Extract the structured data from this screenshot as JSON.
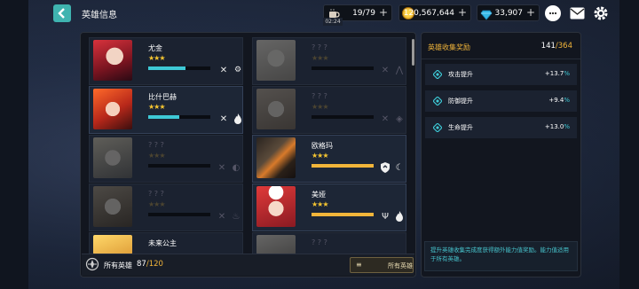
{
  "header": {
    "title": "英雄信息",
    "back_icon": "chevron-left-icon",
    "timer": "02:24"
  },
  "resources": [
    {
      "name": "stamina",
      "icon": "cup-icon",
      "value": "19/79",
      "plus": "+"
    },
    {
      "name": "gold",
      "icon": "coin-icon",
      "value": "120,567,644",
      "plus": "+"
    },
    {
      "name": "gems",
      "icon": "diamond-icon",
      "value": "33,907",
      "plus": "+"
    }
  ],
  "top_buttons": [
    "chat-icon",
    "mail-icon",
    "gear-icon"
  ],
  "heroes": [
    {
      "name": "尤金",
      "stars": "★★★",
      "locked": false,
      "progress": 0.6,
      "bar": "cyan",
      "icons": [
        "swords-icon",
        "settings-icon"
      ]
    },
    {
      "name": "? ? ?",
      "stars": "★★★",
      "locked": true,
      "progress": 0,
      "icons": [
        "swords-icon",
        "mountain-icon"
      ]
    },
    {
      "name": "比什巴赫",
      "stars": "★★★",
      "locked": false,
      "progress": 0.5,
      "bar": "cyan",
      "icons": [
        "swords-icon",
        "fire-icon"
      ]
    },
    {
      "name": "? ? ?",
      "stars": "★★★",
      "locked": true,
      "progress": 0,
      "icons": [
        "swords-icon",
        "diamond-element-icon"
      ]
    },
    {
      "name": "? ? ?",
      "stars": "★★★",
      "locked": true,
      "progress": 0,
      "icons": [
        "swords-icon",
        "water-drop-icon"
      ]
    },
    {
      "name": "欧格玛",
      "stars": "★★★",
      "locked": false,
      "progress": 1.0,
      "bar": "gold",
      "icons": [
        "shield-icon",
        "moon-icon"
      ]
    },
    {
      "name": "? ? ?",
      "stars": "★★★",
      "locked": true,
      "progress": 0,
      "icons": [
        "swords-icon",
        "fire-icon"
      ]
    },
    {
      "name": "美娅",
      "stars": "★★★",
      "locked": false,
      "progress": 1.0,
      "bar": "gold",
      "icons": [
        "staff-icon",
        "fire-icon"
      ]
    },
    {
      "name": "未来公主",
      "locked": false
    },
    {
      "name": "? ? ?",
      "locked": true
    }
  ],
  "footer": {
    "label": "所有英雄",
    "count": "87",
    "total": "/120",
    "filter_button": "所有英雄"
  },
  "reward_panel": {
    "title": "英雄收集奖励",
    "progress": "141",
    "progress_total": "/364",
    "stats": [
      {
        "label": "攻击提升",
        "value": "+13.7",
        "unit": "%"
      },
      {
        "label": "防御提升",
        "value": "+9.4",
        "unit": "%"
      },
      {
        "label": "生命提升",
        "value": "+13.0",
        "unit": "%"
      }
    ],
    "note": "提升英雄收集完成度获得额外能力值奖励。能力值适用于所有英雄。"
  },
  "colors": {
    "accent": "#3fb4b0",
    "cyan": "#3ec9d6",
    "gold": "#f2b53a",
    "stars": "#f5c531"
  }
}
